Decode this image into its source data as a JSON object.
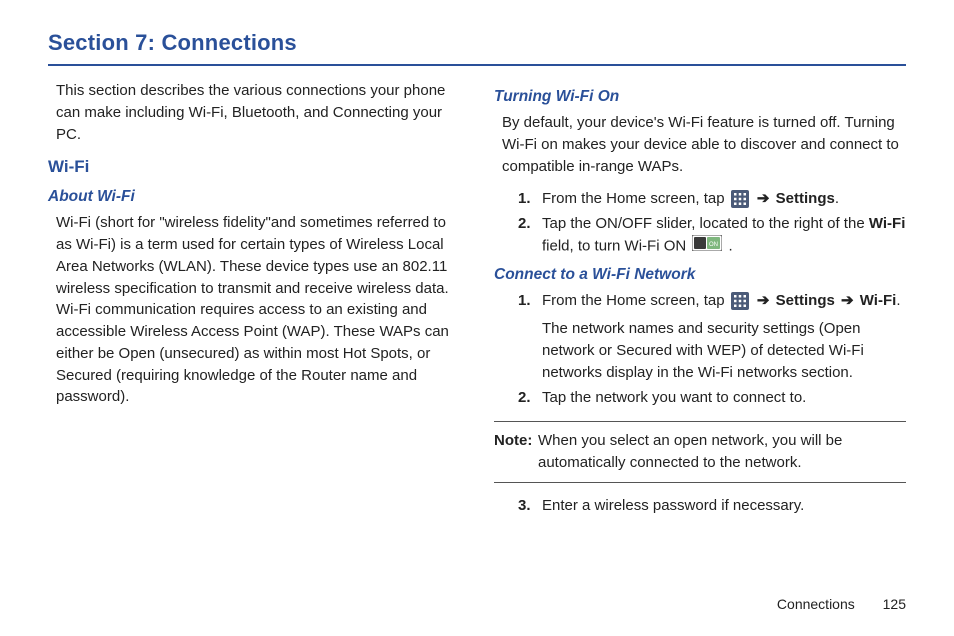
{
  "section_title": "Section 7: Connections",
  "left": {
    "intro": "This section describes the various connections your phone can make including Wi-Fi, Bluetooth, and Connecting your PC.",
    "h_wifi": "Wi-Fi",
    "h_about": "About Wi-Fi",
    "about_body": "Wi-Fi (short for \"wireless fidelity\"and sometimes referred to as Wi-Fi) is a term used for certain types of Wireless Local Area Networks (WLAN). These device types use an 802.11 wireless specification to transmit and receive wireless data. Wi-Fi communication requires access to an existing and accessible Wireless Access Point (WAP). These WAPs can either be Open (unsecured) as within most Hot Spots, or Secured (requiring knowledge of the Router name and password)."
  },
  "right": {
    "h_turning": "Turning Wi-Fi On",
    "turning_body": "By default, your device's Wi-Fi feature is turned off. Turning Wi-Fi on makes your device able to discover and connect to compatible in-range WAPs.",
    "steps_on": [
      {
        "n": "1.",
        "pre": "From the Home screen, tap ",
        "arrow": "➔",
        "after_label": "Settings",
        "tail": "."
      },
      {
        "n": "2.",
        "pre": "Tap the ON/OFF slider, located to the right of the ",
        "bold1": "Wi-Fi",
        "mid": " field, to turn Wi-Fi ON ",
        "tail": "."
      }
    ],
    "h_connect": "Connect to a Wi-Fi Network",
    "steps_connect": [
      {
        "n": "1.",
        "pre": "From the Home screen, tap ",
        "arrow": "➔",
        "label1": "Settings",
        "arrow2": "➔",
        "label2": "Wi-Fi",
        "tail": ".",
        "sub": "The network names and security settings (Open network or Secured with WEP) of detected Wi-Fi networks display in the Wi-Fi networks section."
      },
      {
        "n": "2.",
        "text": "Tap the network you want to connect to."
      }
    ],
    "note_label": "Note:",
    "note_body": "When you select an open network, you will be automatically connected to the network.",
    "step3": {
      "n": "3.",
      "text": "Enter a wireless password if necessary."
    }
  },
  "footer": {
    "section": "Connections",
    "page": "125"
  }
}
